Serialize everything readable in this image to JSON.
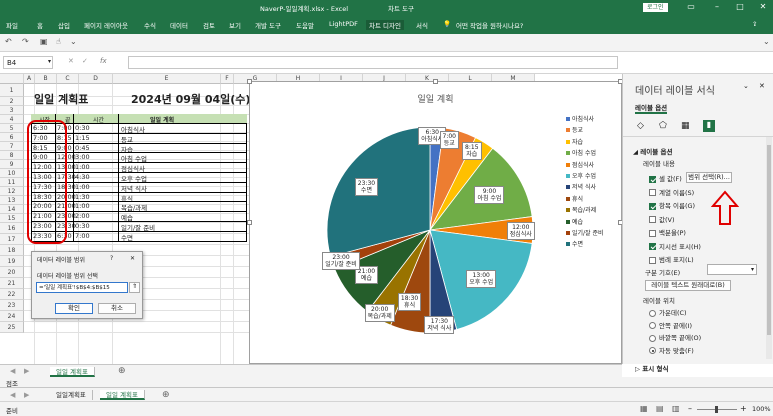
{
  "window": {
    "title": "NaverP-일일계획.xlsx - Excel",
    "context_tab": "차트 도구",
    "login": "로그인"
  },
  "ribbon": {
    "tabs": [
      "파일",
      "홈",
      "삽입",
      "페이지 레이아웃",
      "수식",
      "데이터",
      "검토",
      "보기",
      "개발 도구",
      "도움말",
      "LightPDF",
      "차트 디자인",
      "서식"
    ],
    "tell_me": "어떤 작업을 원하시나요?"
  },
  "formula_bar": {
    "name_box": "B4",
    "fx": "fx",
    "formula": ""
  },
  "columns": [
    "A",
    "B",
    "C",
    "D",
    "E",
    "F",
    "G",
    "H",
    "I",
    "J",
    "K",
    "L",
    "M"
  ],
  "rows": [
    "1",
    "2",
    "3",
    "4",
    "5",
    "6",
    "7",
    "8",
    "9",
    "10",
    "11",
    "12",
    "13",
    "14",
    "15",
    "16",
    "17",
    "18",
    "19",
    "20",
    "21",
    "22",
    "23",
    "24",
    "25"
  ],
  "sheet": {
    "title": "일일 계획표",
    "date": "2024년 09월 04일(수)",
    "headers": [
      "시작",
      "끝",
      "시간",
      "일일 계획"
    ],
    "rows": [
      [
        "6:30",
        "7:00",
        "0:30",
        "아침식사"
      ],
      [
        "7:00",
        "8:15",
        "1:15",
        "등교"
      ],
      [
        "8:15",
        "9:00",
        "0:45",
        "자습"
      ],
      [
        "9:00",
        "12:00",
        "3:00",
        "아침 수업"
      ],
      [
        "12:00",
        "13:00",
        "1:00",
        "점심식사"
      ],
      [
        "13:00",
        "17:30",
        "4:30",
        "오후 수업"
      ],
      [
        "17:30",
        "18:30",
        "1:00",
        "저녁 식사"
      ],
      [
        "18:30",
        "20:00",
        "1:30",
        "휴식"
      ],
      [
        "20:00",
        "21:00",
        "1:00",
        "복습/과제"
      ],
      [
        "21:00",
        "23:00",
        "2:00",
        "예습"
      ],
      [
        "23:00",
        "23:30",
        "0:30",
        "일기/잘 준비"
      ],
      [
        "23:30",
        "6:30",
        "7:00",
        "수면"
      ]
    ]
  },
  "chart_data": {
    "type": "pie",
    "title": "일일 계획",
    "categories": [
      "아침식사",
      "등교",
      "자습",
      "아침 수업",
      "점심식사",
      "오후 수업",
      "저녁 식사",
      "휴식",
      "복습/과제",
      "예습",
      "일기/잘 준비",
      "수면"
    ],
    "values": [
      0.5,
      1.25,
      0.75,
      3,
      1,
      4.5,
      1,
      1.5,
      1,
      2,
      0.5,
      7
    ],
    "colors": [
      "#4472c4",
      "#ed7d31",
      "#ffc000",
      "#70ad47",
      "#f07f09",
      "#45b8c4",
      "#264478",
      "#9e480e",
      "#997300",
      "#255e2b",
      "#a3410c",
      "#21727c"
    ],
    "data_labels": [
      {
        "time": "6:30",
        "label": "아침식사"
      },
      {
        "time": "7:00",
        "label": "등교"
      },
      {
        "time": "8:15",
        "label": "자습"
      },
      {
        "time": "9:00",
        "label": "아침 수업"
      },
      {
        "time": "12:00",
        "label": "점심식사"
      },
      {
        "time": "13:00",
        "label": "오후 수업"
      },
      {
        "time": "17:30",
        "label": "저녁 식사"
      },
      {
        "time": "18:30",
        "label": "휴식"
      },
      {
        "time": "20:00",
        "label": "복습/과제"
      },
      {
        "time": "21:00",
        "label": "예습"
      },
      {
        "time": "23:00",
        "label": "일기/잘 준비"
      },
      {
        "time": "23:30",
        "label": "수면"
      }
    ],
    "legend_position": "right"
  },
  "dialog": {
    "title": "데이터 레이블 범위",
    "help": "?",
    "close": "✕",
    "prompt": "데이터 레이블 범위 선택",
    "value": "='일일 계획표'!$B$4:$B$15",
    "ok": "확인",
    "cancel": "취소"
  },
  "pane": {
    "title": "데이터 레이블 서식",
    "section_tab": "레이블 옵션",
    "group": "레이블 옵션",
    "sub": "레이블 내용",
    "options": [
      {
        "label": "셀 값(F)",
        "checked": true
      },
      {
        "label": "계열 이름(S)",
        "checked": false
      },
      {
        "label": "항목 이름(G)",
        "checked": true
      },
      {
        "label": "값(V)",
        "checked": false
      },
      {
        "label": "백분율(P)",
        "checked": false
      },
      {
        "label": "지시선 표시(H)",
        "checked": true
      },
      {
        "label": "범례 표지(L)",
        "checked": false
      }
    ],
    "range_button": "범위 선택(R)...",
    "separator_label": "구분 기호(E)",
    "reset_button": "레이블 텍스트 원래대로(B)",
    "position_label": "레이블 위치",
    "positions": [
      {
        "label": "가운데(C)",
        "selected": false
      },
      {
        "label": "안쪽 끝에(I)",
        "selected": false
      },
      {
        "label": "바깥쪽 끝에(O)",
        "selected": false
      },
      {
        "label": "자동 맞춤(F)",
        "selected": true
      }
    ],
    "number_section": "표시 형식"
  },
  "sheet_tabs_top": [
    "일일 계획표"
  ],
  "sheet_tabs_bottom": [
    "일일계획표",
    "일일 계획표"
  ],
  "status": {
    "ready_top": "점조",
    "ready_bottom": "준비",
    "zoom": "100%"
  }
}
